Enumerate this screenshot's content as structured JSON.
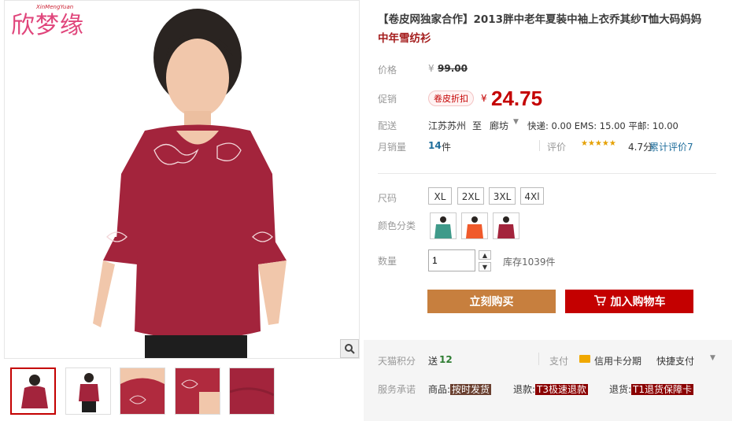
{
  "brand": {
    "logo_text": "欣梦缘",
    "logo_sub": "XinMengYuan"
  },
  "title": {
    "main": "【卷皮网独家合作】2013胖中老年夏装中袖上衣乔其纱T恤大码妈妈",
    "sub": "中年雪纺衫"
  },
  "price": {
    "label": "价格",
    "currency": "¥",
    "original": "99.00"
  },
  "promo": {
    "label": "促销",
    "tag": "卷皮折扣",
    "currency": "¥",
    "value": "24.75"
  },
  "shipping": {
    "label": "配送",
    "from": "江苏苏州",
    "to_word": "至",
    "to": "廊坊",
    "fees": "快递: 0.00 EMS: 15.00 平邮: 10.00"
  },
  "sales": {
    "label": "月销量",
    "count": "14",
    "unit": "件",
    "review_label": "评价",
    "stars": "★★★★★",
    "rating": "4.7分",
    "review_count": "累计评价7"
  },
  "size": {
    "label": "尺码",
    "options": [
      "XL",
      "2XL",
      "3XL",
      "4Xl"
    ]
  },
  "color": {
    "label": "颜色分类",
    "options": [
      {
        "name": "green",
        "hex": "#3f9a8a"
      },
      {
        "name": "orange",
        "hex": "#f05a2b"
      },
      {
        "name": "red",
        "hex": "#a3243c"
      }
    ]
  },
  "quantity": {
    "label": "数量",
    "value": "1",
    "stock": "库存1039件"
  },
  "buttons": {
    "buy": "立刻购买",
    "cart": "加入购物车"
  },
  "tmall": {
    "label": "天猫积分",
    "send": "送",
    "points": "12"
  },
  "payment": {
    "label": "支付",
    "credit": "信用卡分期",
    "fast": "快捷支付"
  },
  "service": {
    "label": "服务承诺",
    "goods": "商品:",
    "goods_tag": "按时发货",
    "refund": "退款:",
    "refund_tag": "T3极速退款",
    "return": "退货:",
    "return_tag": "T1退货保障卡"
  },
  "colors": {
    "accent": "#c40000",
    "buy": "#c77f3e",
    "shirt": "#a3243c"
  }
}
